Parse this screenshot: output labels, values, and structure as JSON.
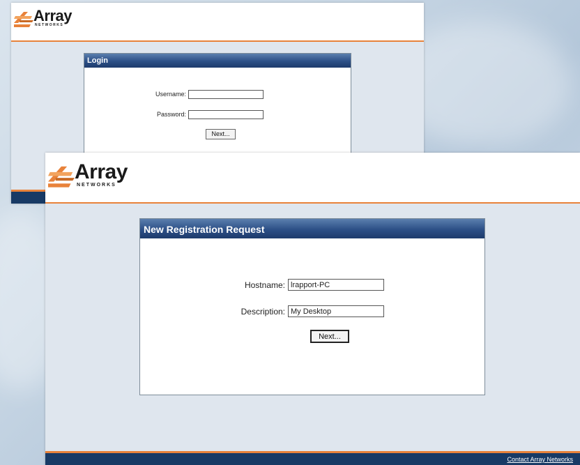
{
  "brand": {
    "name": "Array",
    "tagline": "NETWORKS",
    "accent": "#e8823a",
    "navy": "#1d3b6c"
  },
  "login_window": {
    "panel_title": "Login",
    "username_label": "Username:",
    "username_value": "",
    "password_label": "Password:",
    "password_value": "",
    "next_label": "Next..."
  },
  "registration_window": {
    "panel_title": "New Registration Request",
    "hostname_label": "Hostname:",
    "hostname_value": "lrapport-PC",
    "description_label": "Description:",
    "description_value": "My Desktop",
    "next_label": "Next...",
    "footer_link": "Contact Array Networks"
  }
}
